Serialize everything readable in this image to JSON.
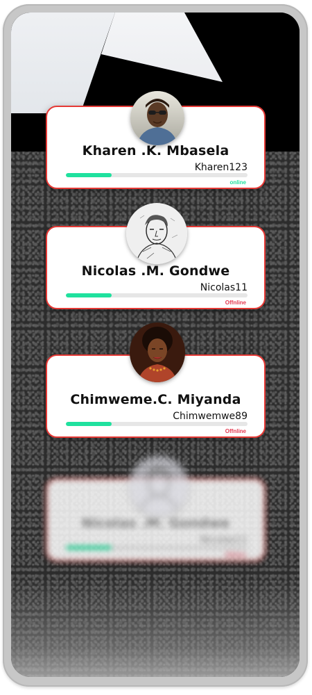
{
  "colors": {
    "card_border": "#e53935",
    "progress_fill": "#1fe19e",
    "progress_track": "#e6e6e6",
    "status_online": "#1fe19e",
    "status_offline": "#e53950"
  },
  "users": [
    {
      "name": "Kharen .K. Mbasela",
      "username": "Kharen123",
      "status": "online",
      "status_color": "#1fe19e",
      "progress_fraction": 0.25,
      "avatar_icon": "woman-with-sunglasses-photo"
    },
    {
      "name": "Nicolas .M. Gondwe",
      "username": "Nicolas11",
      "status": "Offnline",
      "status_color": "#e53950",
      "progress_fraction": 0.25,
      "avatar_icon": "pencil-sketch-portrait"
    },
    {
      "name": "Chimweme.C. Miyanda",
      "username": "Chimwemwe89",
      "status": "Offnline",
      "status_color": "#e53950",
      "progress_fraction": 0.25,
      "avatar_icon": "woman-portrait-photo"
    },
    {
      "name": "Nicolas .M. Gondwe",
      "username": "Nicolas11",
      "status": "Offnline",
      "status_color": "#e53950",
      "progress_fraction": 0.25,
      "avatar_icon": "pencil-sketch-portrait"
    }
  ]
}
